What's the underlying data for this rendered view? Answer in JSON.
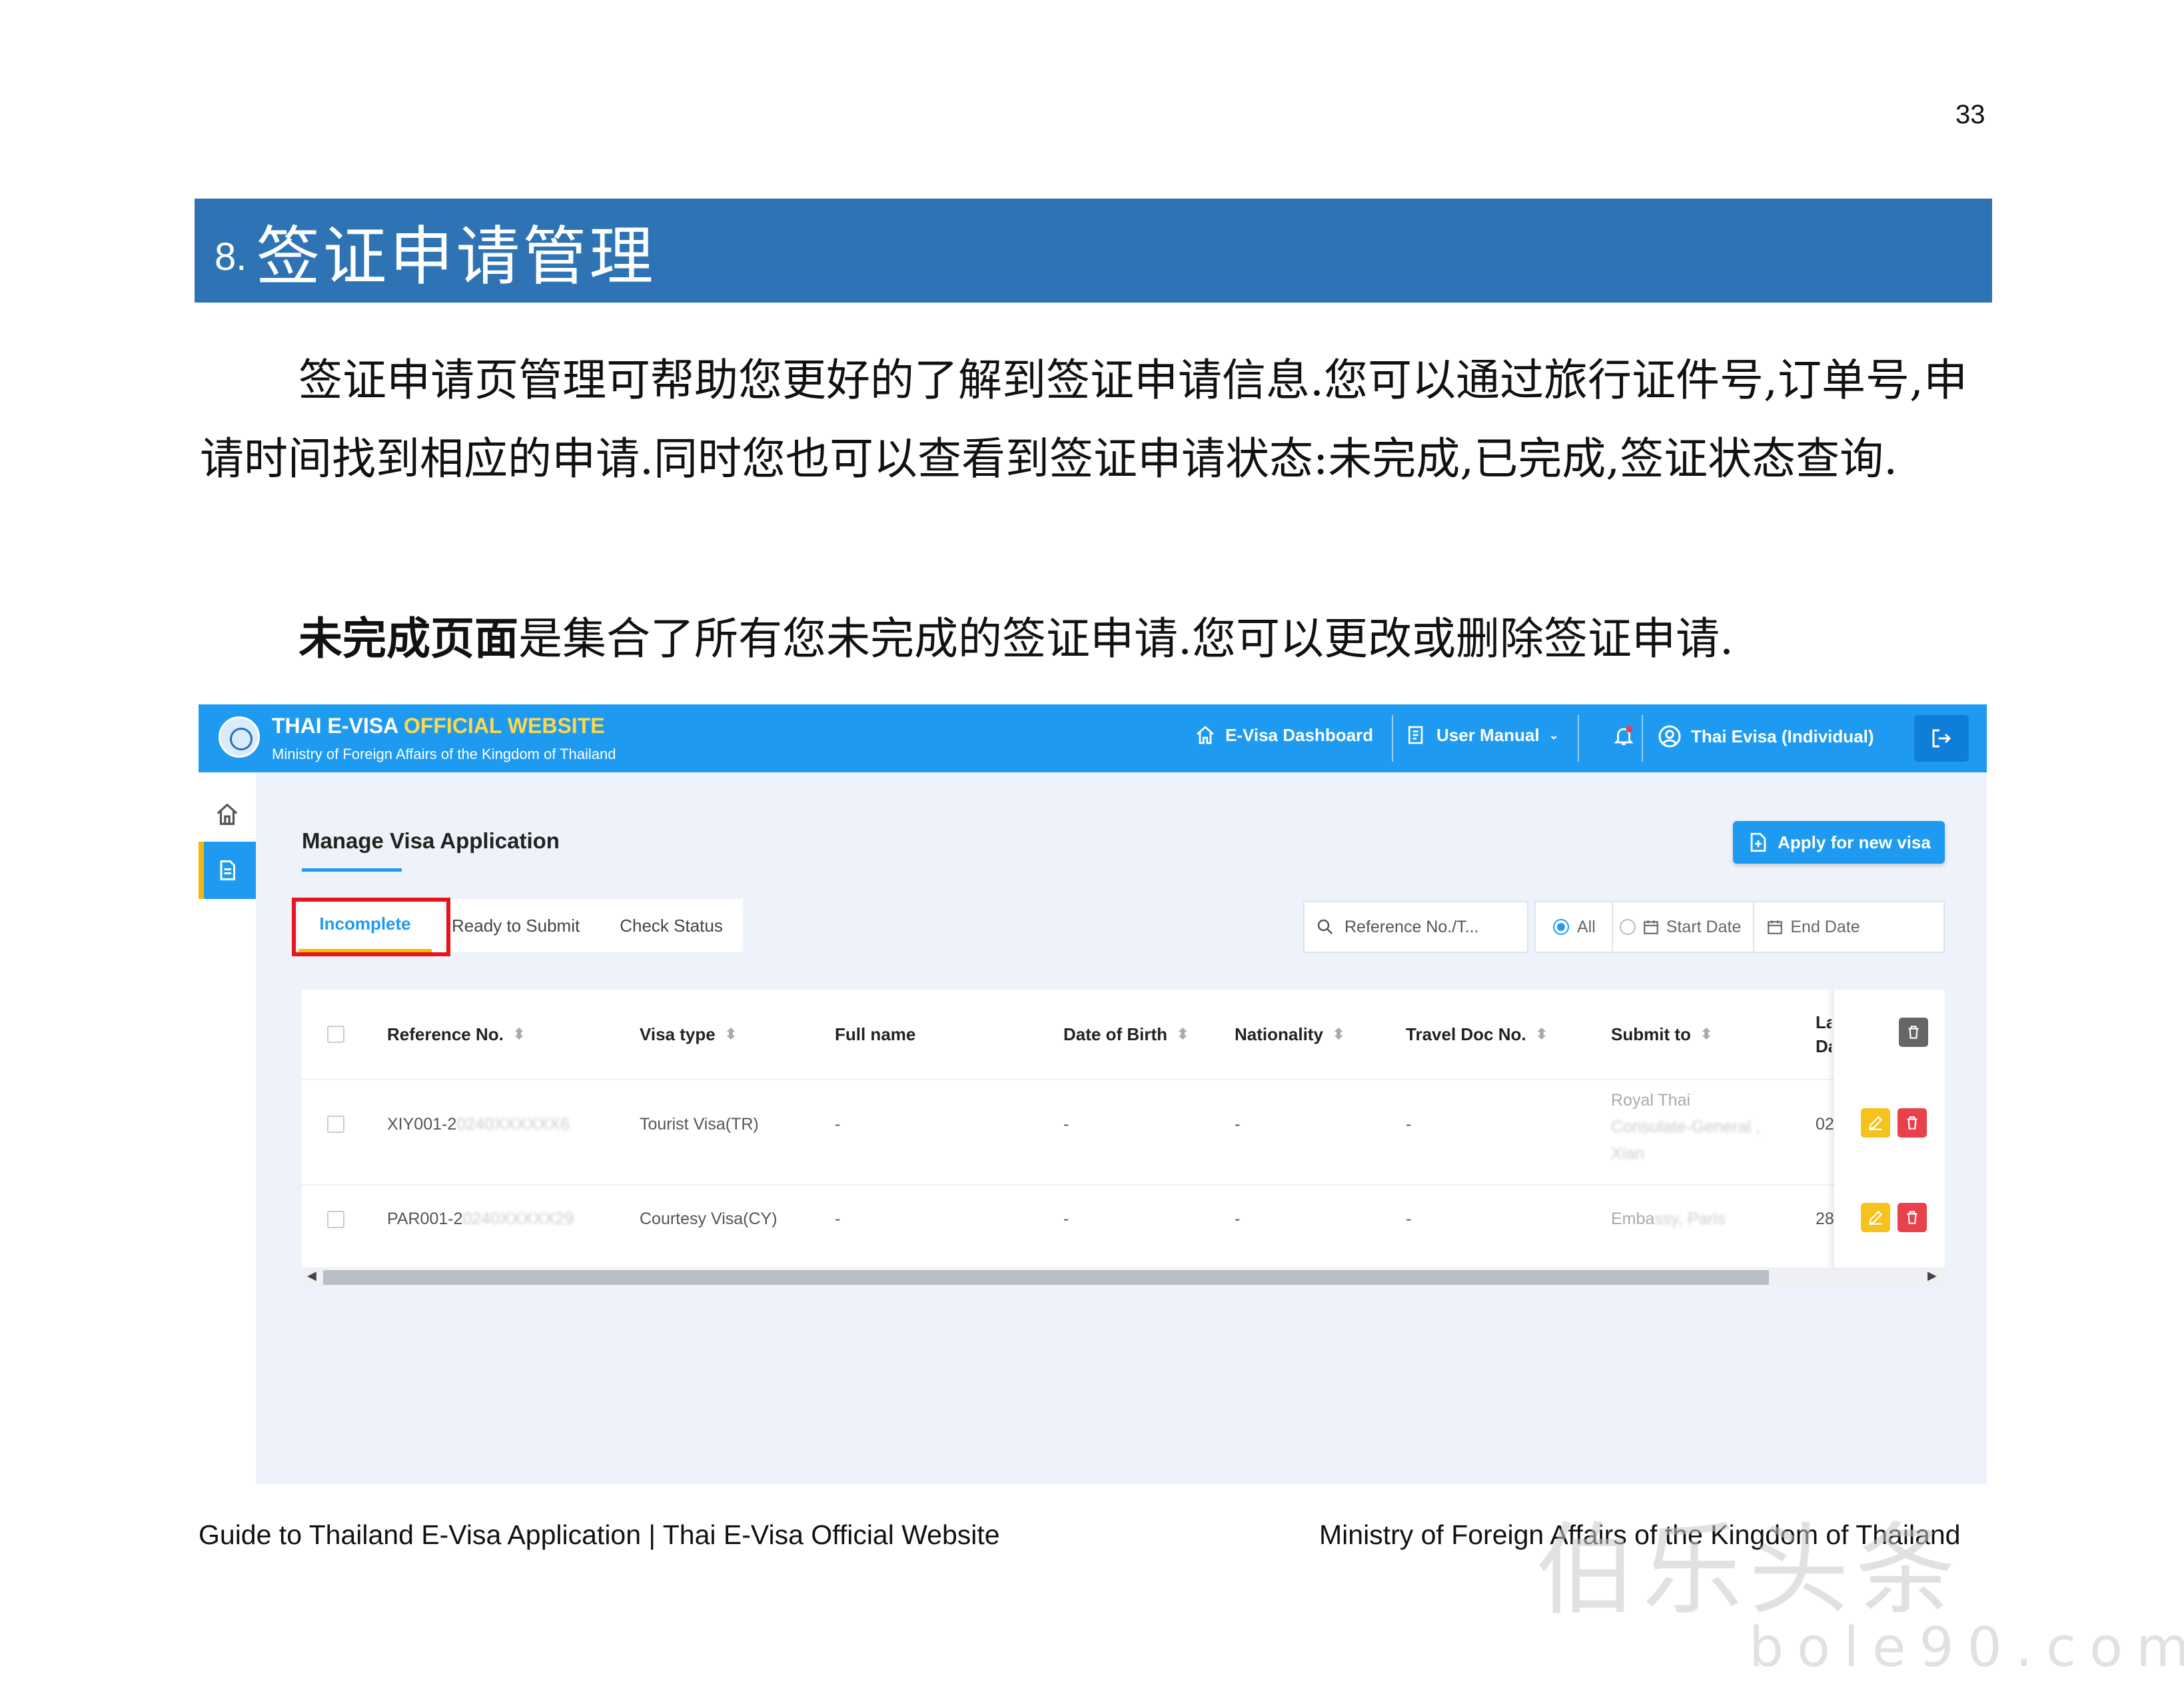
{
  "page_number": "33",
  "section": {
    "number": "8.",
    "title": "签证申请管理"
  },
  "paragraph1": "签证申请页管理可帮助您更好的了解到签证申请信息.您可以通过旅行证件号,订单号,申请时间找到相应的申请.同时您也可以查看到签证申请状态:未完成,已完成,签证状态查询.",
  "paragraph2": {
    "bold": "未完成页面",
    "rest": "是集合了所有您未完成的签证申请.您可以更改或删除签证申请."
  },
  "screenshot": {
    "brand_title_white": "THAI E-VISA",
    "brand_title_yellow": "OFFICIAL WEBSITE",
    "brand_subtitle": "Ministry of Foreign Affairs of the Kingdom of Thailand",
    "nav": {
      "dashboard": "E-Visa Dashboard",
      "manual": "User Manual",
      "user": "Thai Evisa (Individual)"
    },
    "page_title": "Manage Visa Application",
    "apply_button": "Apply for new visa",
    "tabs": [
      "Incomplete",
      "Ready to Submit",
      "Check Status"
    ],
    "search_placeholder": "Reference No./T...",
    "filter_all": "All",
    "start_date": "Start Date",
    "end_date": "End Date",
    "columns": [
      "Reference No.",
      "Visa type",
      "Full name",
      "Date of Birth",
      "Nationality",
      "Travel Doc No.",
      "Submit to",
      "La Da"
    ],
    "rows": [
      {
        "ref": "XIY001-2",
        "ref_blur": "0240XXXXXX6",
        "visa_type": "Tourist Visa(TR)",
        "full_name": "-",
        "dob": "-",
        "nationality": "-",
        "travel_doc": "-",
        "submit_to_1": "Royal Thai",
        "submit_to_2": "Consulate-General ,",
        "submit_to_3": "Xian",
        "last": "02"
      },
      {
        "ref": "PAR001-2",
        "ref_blur": "0240XXXXX29",
        "visa_type": "Courtesy Visa(CY)",
        "full_name": "-",
        "dob": "-",
        "nationality": "-",
        "travel_doc": "-",
        "submit_to_1": "Emba",
        "submit_to_2": "ssy, Paris",
        "last": "28"
      }
    ]
  },
  "footer_left": "Guide to Thailand E-Visa Application | Thai E-Visa Official Website",
  "footer_right": "Ministry of Foreign Affairs of the Kingdom of Thailand",
  "watermark": {
    "main": "伯乐头条",
    "sub": "bole90.com"
  },
  "colors": {
    "section_bar": "#2e74b5",
    "topbar": "#1e9bf0",
    "highlight": "#e8141d",
    "brand_yellow": "#ffd84a"
  }
}
